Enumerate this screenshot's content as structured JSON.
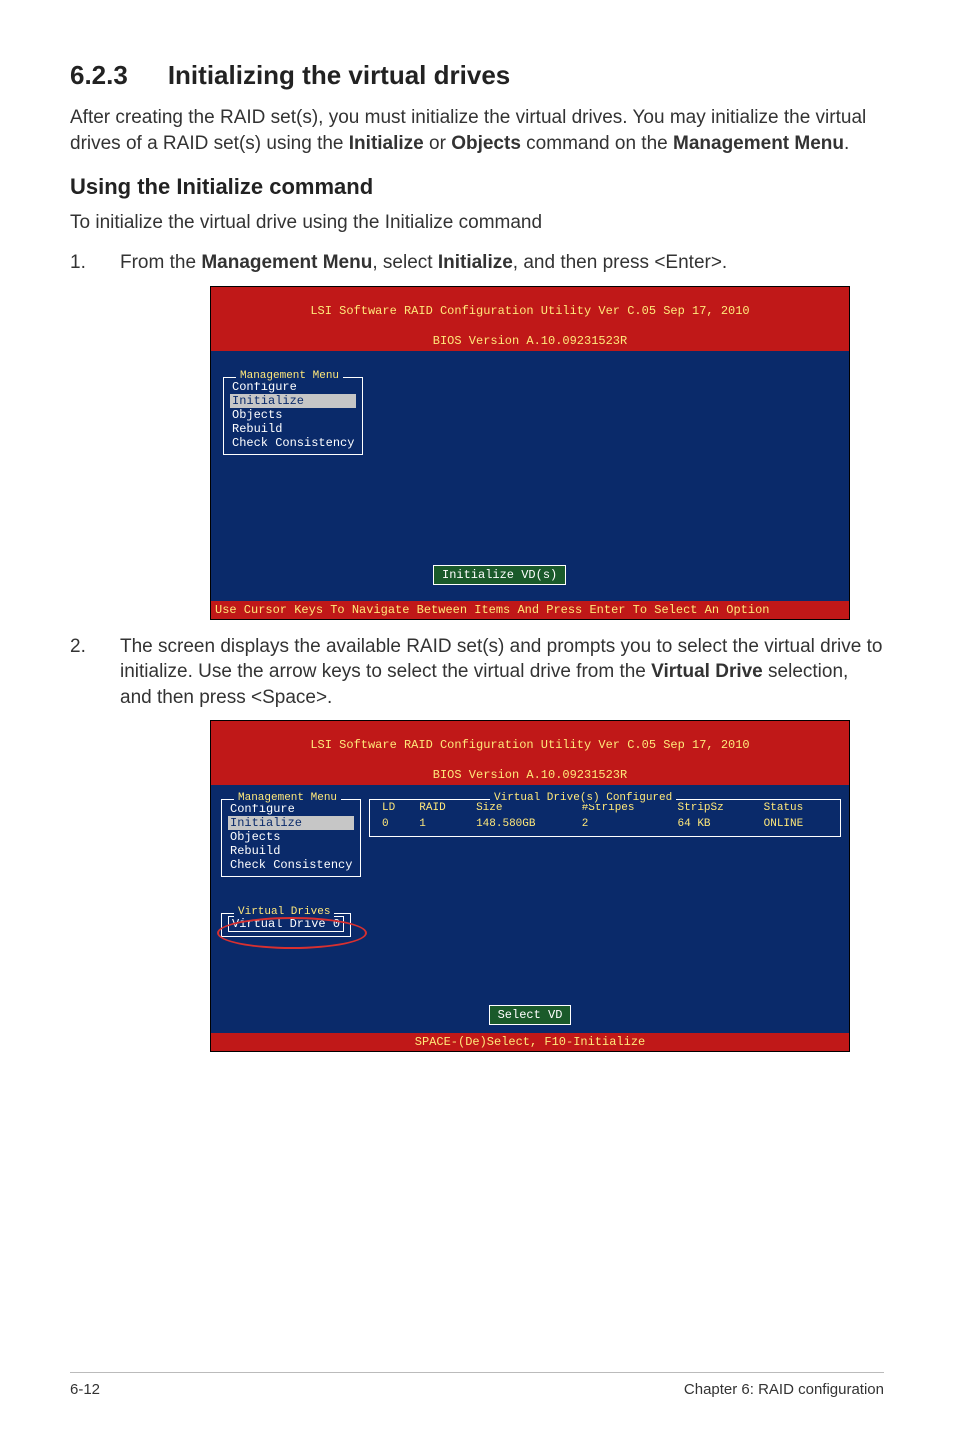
{
  "section": {
    "number": "6.2.3",
    "title": "Initializing the virtual drives"
  },
  "intro": {
    "prefix": "After creating the RAID set(s), you must initialize the virtual drives. You may initialize the virtual drives of a RAID set(s) using the ",
    "bold1": "Initialize",
    "mid1": " or ",
    "bold2": "Objects",
    "mid2": " command on the ",
    "bold3": "Management Menu",
    "suffix": "."
  },
  "subhead": "Using the Initialize command",
  "lead": "To initialize the virtual drive using the Initialize command",
  "step1": {
    "marker": "1.",
    "prefix": "From the ",
    "bold1": "Management Menu",
    "mid1": ", select ",
    "bold2": "Initialize",
    "suffix": ", and then press <Enter>."
  },
  "bios1": {
    "title_line1": "LSI Software RAID Configuration Utility Ver C.05 Sep 17, 2010",
    "title_line2": "BIOS Version   A.10.09231523R",
    "menu_title": "Management Menu",
    "items": {
      "configure": "Configure",
      "initialize": "Initialize",
      "objects": "Objects",
      "rebuild": "Rebuild",
      "check": "Check Consistency"
    },
    "tooltip": "Initialize VD(s)",
    "footer": "Use Cursor Keys To Navigate Between Items And Press Enter To Select An Option"
  },
  "step2": {
    "marker": "2.",
    "line1_prefix": "The screen displays the available RAID set(s) and prompts you to select the virtual drive to initialize. Use the arrow keys to select the virtual drive from the ",
    "bold1": "Virtual Drive",
    "line1_suffix": " selection, and then press <Space>."
  },
  "bios2": {
    "title_line1": "LSI Software RAID Configuration Utility Ver C.05 Sep 17, 2010",
    "title_line2": "BIOS Version   A.10.09231523R",
    "menu_title": "Management Menu",
    "items": {
      "configure": "Configure",
      "initialize": "Initialize",
      "objects": "Objects",
      "rebuild": "Rebuild",
      "check": "Check Consistency"
    },
    "table_title": "Virtual Drive(s) Configured",
    "headers": {
      "ld": "LD",
      "raid": "RAID",
      "size": "Size",
      "stripes": "#Stripes",
      "stripsz": "StripSz",
      "status": "Status"
    },
    "row": {
      "ld": "0",
      "raid": "1",
      "size": "148.580GB",
      "stripes": "2",
      "stripsz": "64 KB",
      "status": "ONLINE"
    },
    "vd_title": "Virtual Drives",
    "vd_item": "Virtual Drive 0",
    "tooltip": "Select VD",
    "footer": "SPACE-(De)Select,  F10-Initialize"
  },
  "footer": {
    "left": "6-12",
    "right": "Chapter 6: RAID configuration"
  }
}
